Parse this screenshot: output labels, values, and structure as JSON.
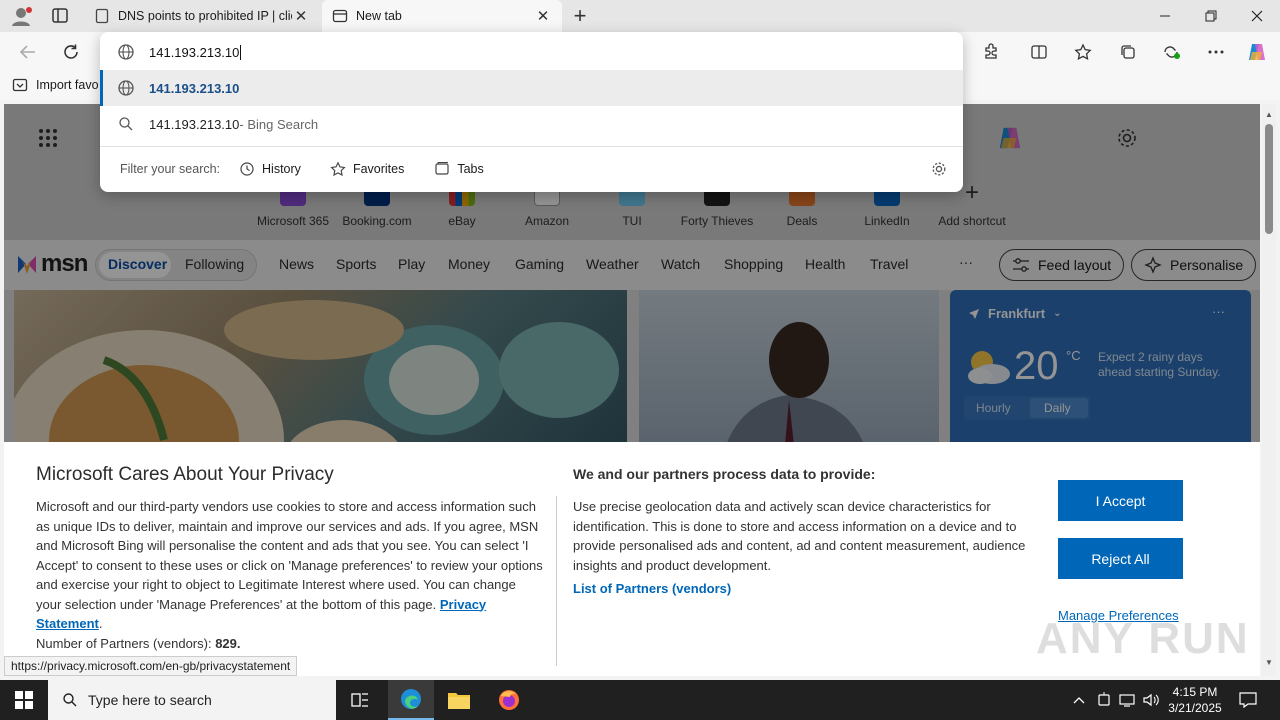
{
  "browser": {
    "tabs": [
      {
        "label": "DNS points to prohibited IP | clie",
        "icon": "document-icon"
      },
      {
        "label": "New tab",
        "icon": "newtab-icon"
      }
    ],
    "new_tab_symbol": "+",
    "close_symbol": "✕"
  },
  "omnibox": {
    "value": "141.193.213.10",
    "suggestion_url": "141.193.213.10",
    "suggestion_search_query": "141.193.213.10",
    "suggestion_search_suffix": " - Bing Search",
    "filter_label": "Filter your search:",
    "filters": [
      "History",
      "Favorites",
      "Tabs"
    ]
  },
  "favorites_bar": {
    "import_label": "Import favo"
  },
  "shortcuts": [
    "Microsoft 365",
    "Booking.com",
    "eBay",
    "Amazon",
    "TUI",
    "Forty Thieves",
    "Deals",
    "LinkedIn",
    "Add shortcut"
  ],
  "msn": {
    "logo": "msn",
    "nav": [
      "Discover",
      "Following",
      "News",
      "Sports",
      "Play",
      "Money",
      "Gaming",
      "Weather",
      "Watch",
      "Shopping",
      "Health",
      "Travel"
    ],
    "more": "···",
    "feed_layout": "Feed layout",
    "personalise": "Personalise"
  },
  "weather": {
    "city": "Frankfurt",
    "temp": "20",
    "unit": "°C",
    "note": "Expect 2 rainy days ahead starting Sunday.",
    "tabs": [
      "Hourly",
      "Daily"
    ],
    "more": "···"
  },
  "consent": {
    "title": "Microsoft Cares About Your Privacy",
    "body": "Microsoft and our third-party vendors use cookies to store and access information such as unique IDs to deliver, maintain and improve our services and ads. If you agree, MSN and Microsoft Bing will personalise the content and ads that you see. You can select 'I Accept' to consent to these uses or click on 'Manage preferences' to review your options and exercise your right to object to Legitimate Interest where used.  You can change your selection under 'Manage Preferences' at the bottom of this page.",
    "privacy_link": "Privacy Statement",
    "partners_label": "Number of Partners (vendors):",
    "partners_count": "829.",
    "right_title": "We and our partners process data to provide:",
    "right_body": "Use precise geolocation data and actively scan device characteristics for identification. This is done to store and access information on a device and to provide personalised ads and content, ad and content measurement, audience insights and product development.",
    "vendors_link": "List of Partners (vendors)",
    "accept": "I Accept",
    "reject": "Reject All",
    "manage": "Manage Preferences"
  },
  "status_url": "https://privacy.microsoft.com/en-gb/privacystatement",
  "watermark": "ANY RUN",
  "taskbar": {
    "search_placeholder": "Type here to search",
    "time": "4:15 PM",
    "date": "3/21/2025"
  },
  "colors": {
    "accent": "#0067b8",
    "link": "#0067b8",
    "msn_blue": "#1a62c7"
  }
}
